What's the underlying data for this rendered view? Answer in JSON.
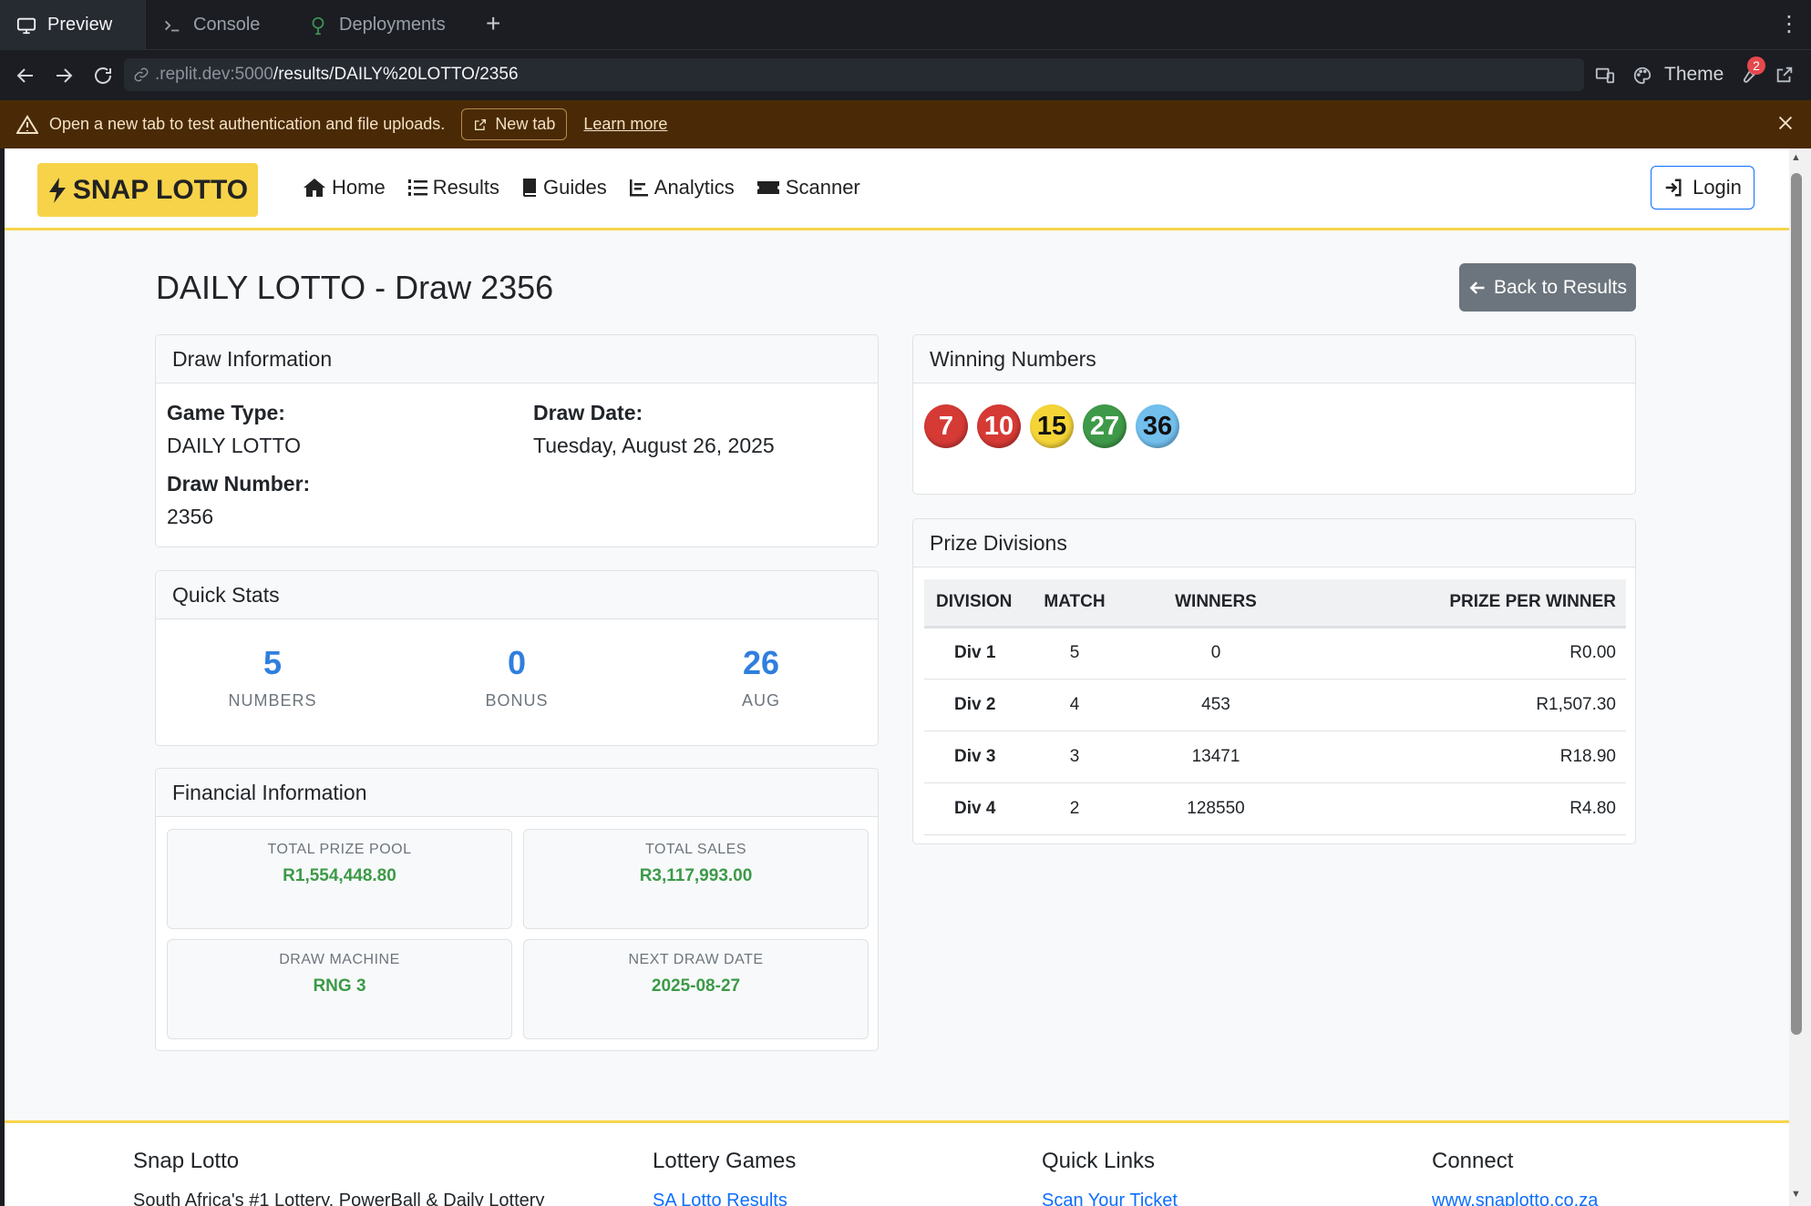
{
  "browser": {
    "tabs": [
      {
        "label": "Preview",
        "icon": "monitor-icon"
      },
      {
        "label": "Console",
        "icon": "terminal-icon"
      },
      {
        "label": "Deployments",
        "icon": "deploy-icon"
      }
    ],
    "url_host": ".replit.dev:5000",
    "url_path": "/results/DAILY%20LOTTO/2356",
    "theme_label": "Theme",
    "notification_count": "2"
  },
  "banner": {
    "message": "Open a new tab to test authentication and file uploads.",
    "new_tab_label": "New tab",
    "learn_more_label": "Learn more"
  },
  "nav": {
    "brand": "SNAP LOTTO",
    "links": [
      {
        "label": "Home",
        "icon": "home-icon"
      },
      {
        "label": "Results",
        "icon": "list-ol-icon"
      },
      {
        "label": "Guides",
        "icon": "book-icon"
      },
      {
        "label": "Analytics",
        "icon": "chart-line-icon"
      },
      {
        "label": "Scanner",
        "icon": "ticket-icon"
      }
    ],
    "login_label": "Login"
  },
  "page": {
    "title": "DAILY LOTTO - Draw 2356",
    "back_label": "Back to Results"
  },
  "draw_info": {
    "header": "Draw Information",
    "game_type_label": "Game Type:",
    "game_type": "DAILY LOTTO",
    "draw_date_label": "Draw Date:",
    "draw_date": "Tuesday, August 26, 2025",
    "draw_number_label": "Draw Number:",
    "draw_number": "2356"
  },
  "quick_stats": {
    "header": "Quick Stats",
    "items": [
      {
        "value": "5",
        "label": "NUMBERS"
      },
      {
        "value": "0",
        "label": "BONUS"
      },
      {
        "value": "26",
        "label": "AUG"
      }
    ]
  },
  "financial": {
    "header": "Financial Information",
    "items": [
      {
        "label": "TOTAL PRIZE POOL",
        "value": "R1,554,448.80"
      },
      {
        "label": "TOTAL SALES",
        "value": "R3,117,993.00"
      },
      {
        "label": "DRAW MACHINE",
        "value": "RNG 3"
      },
      {
        "label": "NEXT DRAW DATE",
        "value": "2025-08-27"
      }
    ]
  },
  "winning": {
    "header": "Winning Numbers",
    "balls": [
      {
        "number": "7",
        "color": "#d63a35",
        "text_color": "#ffffff"
      },
      {
        "number": "10",
        "color": "#d63a35",
        "text_color": "#ffffff"
      },
      {
        "number": "15",
        "color": "#f5d437",
        "text_color": "#111111"
      },
      {
        "number": "27",
        "color": "#3e9a48",
        "text_color": "#ffffff"
      },
      {
        "number": "36",
        "color": "#72bfee",
        "text_color": "#111111"
      }
    ]
  },
  "prizes": {
    "header": "Prize Divisions",
    "columns": [
      "DIVISION",
      "MATCH",
      "WINNERS",
      "PRIZE PER WINNER"
    ],
    "rows": [
      {
        "division": "Div 1",
        "match": "5",
        "winners": "0",
        "prize": "R0.00"
      },
      {
        "division": "Div 2",
        "match": "4",
        "winners": "453",
        "prize": "R1,507.30"
      },
      {
        "division": "Div 3",
        "match": "3",
        "winners": "13471",
        "prize": "R18.90"
      },
      {
        "division": "Div 4",
        "match": "2",
        "winners": "128550",
        "prize": "R4.80"
      }
    ]
  },
  "footer": {
    "col1_title": "Snap Lotto",
    "col1_text": "South Africa's #1 Lottery, PowerBall & Daily Lottery",
    "col2_title": "Lottery Games",
    "col2_link": "SA Lotto Results",
    "col3_title": "Quick Links",
    "col3_link": "Scan Your Ticket",
    "col4_title": "Connect",
    "col4_link": "www.snaplotto.co.za"
  }
}
